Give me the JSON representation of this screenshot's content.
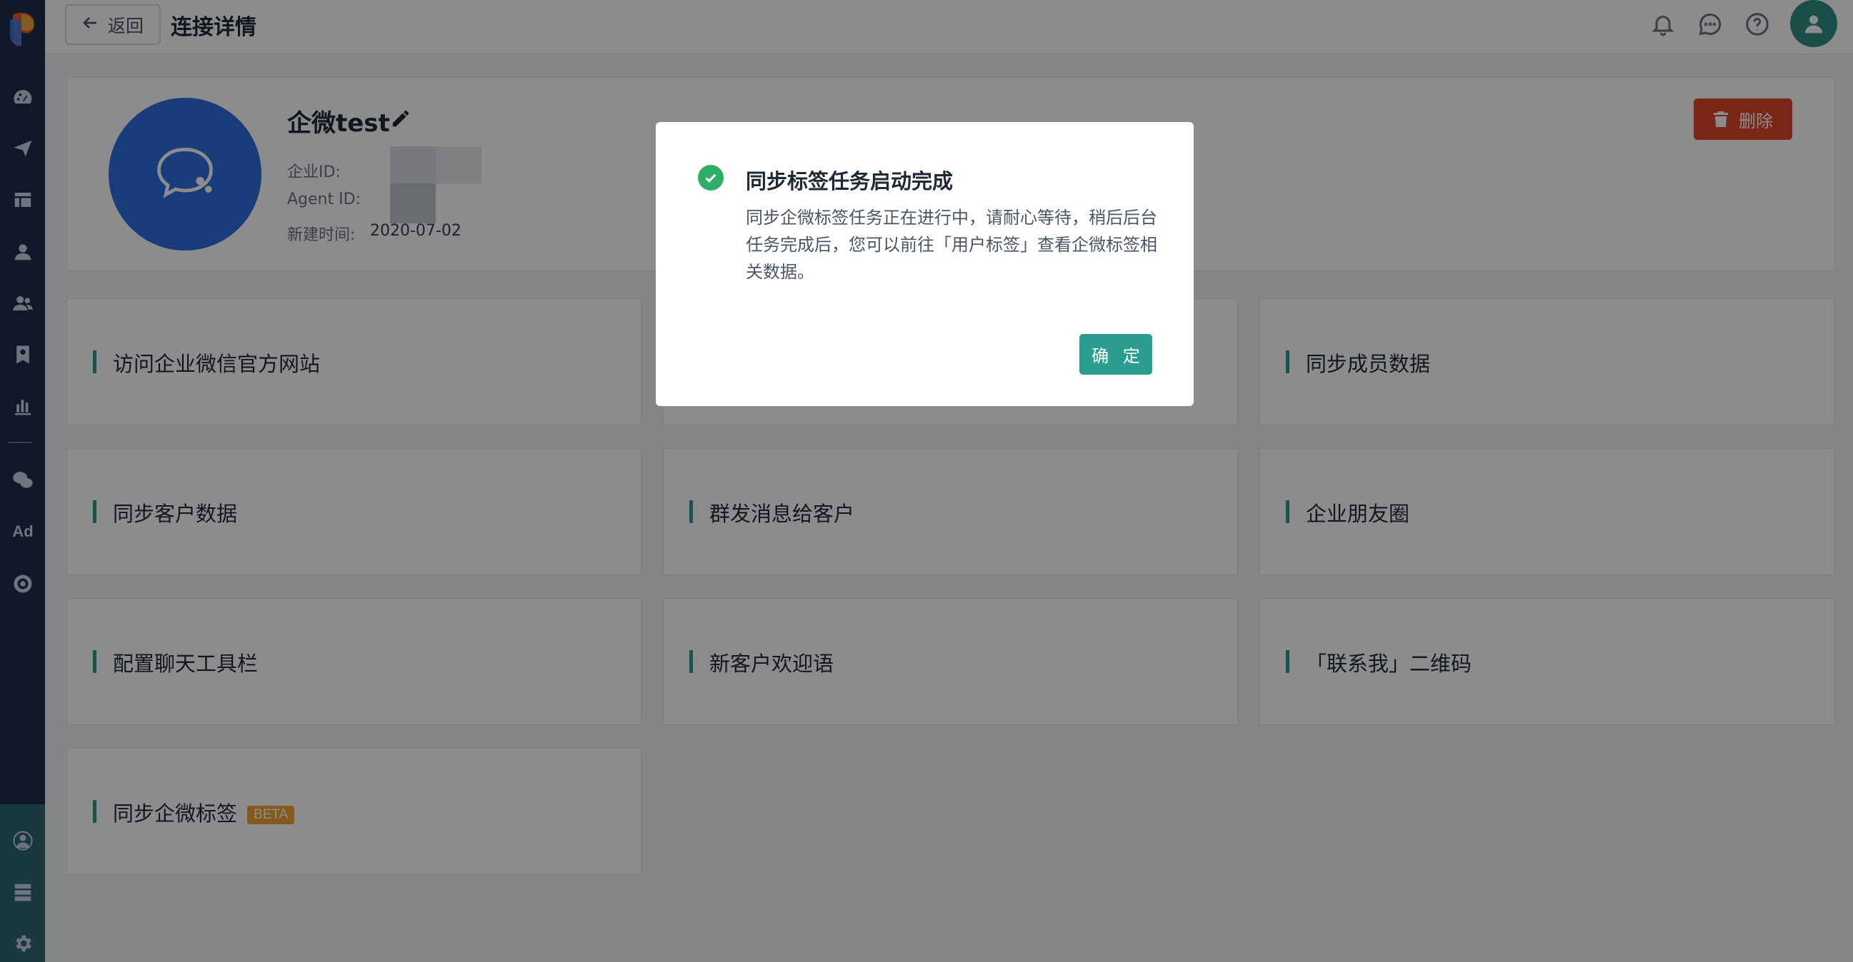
{
  "header": {
    "back_label": "返回",
    "title": "连接详情"
  },
  "profile": {
    "name": "企微test",
    "corp_id_label": "企业ID:",
    "agent_id_label": "Agent ID:",
    "created_label": "新建时间:",
    "created_value": "2020-07-02",
    "delete_label": "删除"
  },
  "sidebar": {
    "ad_label": "Ad",
    "icons": [
      "dashboard-icon",
      "send-icon",
      "layout-icon",
      "user-icon",
      "users-icon",
      "badge-icon",
      "bar-chart-icon",
      "wechat-icon",
      "ad-icon",
      "target-icon",
      "team-icon",
      "server-icon",
      "settings-icon"
    ]
  },
  "cards": [
    {
      "label": "访问企业微信官方网站"
    },
    {
      "label": ""
    },
    {
      "label": "同步成员数据"
    },
    {
      "label": "同步客户数据"
    },
    {
      "label": "群发消息给客户"
    },
    {
      "label": "企业朋友圈"
    },
    {
      "label": "配置聊天工具栏"
    },
    {
      "label": "新客户欢迎语"
    },
    {
      "label": "「联系我」二维码"
    },
    {
      "label": "同步企微标签",
      "badge": "BETA"
    }
  ],
  "modal": {
    "title": "同步标签任务启动完成",
    "body": "同步企微标签任务正在进行中，请耐心等待，稍后后台任务完成后，您可以前往「用户标签」查看企微标签相关数据。",
    "ok_label": "确 定"
  },
  "colors": {
    "sidebar": "#1d2f4d",
    "accent": "#2a9d8f",
    "danger": "#e0472a",
    "company_avatar": "#2d6fdf",
    "beta_badge": "#f3a53a",
    "success": "#2bae66"
  }
}
